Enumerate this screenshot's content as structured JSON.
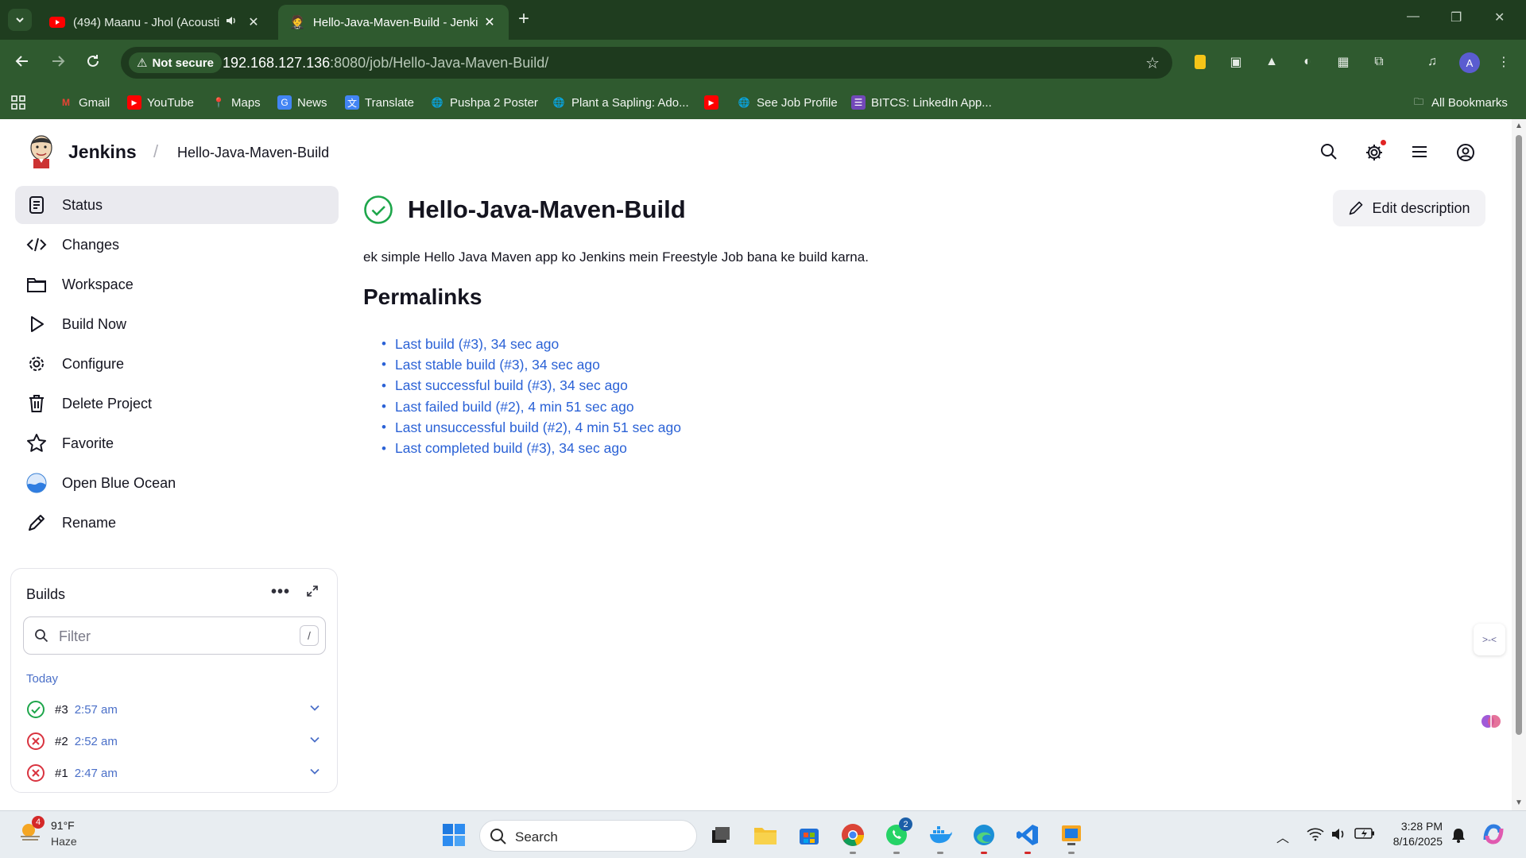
{
  "browser": {
    "tabs": [
      {
        "title": "(494) Maanu - Jhol (Acousti",
        "active": false
      },
      {
        "title": "Hello-Java-Maven-Build - Jenki",
        "active": true
      }
    ],
    "not_secure_label": "Not secure",
    "url_host": "192.168.127.136",
    "url_rest": ":8080/job/Hello-Java-Maven-Build/",
    "profile_initial": "A",
    "bookmarks": [
      {
        "label": "Gmail"
      },
      {
        "label": "YouTube"
      },
      {
        "label": "Maps"
      },
      {
        "label": "News"
      },
      {
        "label": "Translate"
      },
      {
        "label": "Pushpa 2 Poster"
      },
      {
        "label": "Plant a Sapling: Ado..."
      },
      {
        "label": "See Job Profile"
      },
      {
        "label": "BITCS: LinkedIn App..."
      }
    ],
    "all_bookmarks_label": "All Bookmarks"
  },
  "jenkins": {
    "brand": "Jenkins",
    "breadcrumb": "Hello-Java-Maven-Build",
    "sidebar": [
      {
        "label": "Status",
        "icon": "document-icon"
      },
      {
        "label": "Changes",
        "icon": "code-icon"
      },
      {
        "label": "Workspace",
        "icon": "folder-icon"
      },
      {
        "label": "Build Now",
        "icon": "play-icon"
      },
      {
        "label": "Configure",
        "icon": "gear-icon"
      },
      {
        "label": "Delete Project",
        "icon": "trash-icon"
      },
      {
        "label": "Favorite",
        "icon": "star-icon"
      },
      {
        "label": "Open Blue Ocean",
        "icon": "blue-ocean-icon"
      },
      {
        "label": "Rename",
        "icon": "pencil-icon"
      }
    ],
    "builds": {
      "title": "Builds",
      "filter_placeholder": "Filter",
      "filter_shortcut": "/",
      "group_label": "Today",
      "items": [
        {
          "number": "#3",
          "time": "2:57 am",
          "status": "success"
        },
        {
          "number": "#2",
          "time": "2:52 am",
          "status": "failed"
        },
        {
          "number": "#1",
          "time": "2:47 am",
          "status": "failed"
        }
      ]
    },
    "job_title": "Hello-Java-Maven-Build",
    "description": "ek simple Hello Java Maven app ko Jenkins mein Freestyle Job bana ke build karna.",
    "edit_description_label": "Edit description",
    "permalinks_heading": "Permalinks",
    "permalinks": [
      "Last build (#3), 34 sec ago",
      "Last stable build (#3), 34 sec ago",
      "Last successful build (#3), 34 sec ago",
      "Last failed build (#2), 4 min 51 sec ago",
      "Last unsuccessful build (#2), 4 min 51 sec ago",
      "Last completed build (#3), 34 sec ago"
    ],
    "colors": {
      "success": "#1ea64b",
      "failed": "#d9333f",
      "link": "#2b62d6"
    }
  },
  "taskbar": {
    "weather_temp": "91°F",
    "weather_desc": "Haze",
    "weather_badge": "4",
    "search_label": "Search",
    "whatsapp_badge": "2",
    "time": "3:28 PM",
    "date": "8/16/2025"
  }
}
